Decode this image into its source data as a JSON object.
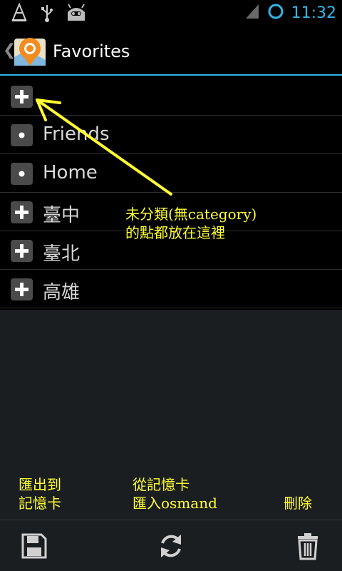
{
  "status_bar": {
    "time": "11:32",
    "left_icons": [
      "vlc-cone-icon",
      "usb-icon",
      "cyanogen-android-icon"
    ],
    "right_icons": [
      "signal-icon",
      "battery-circle-icon"
    ]
  },
  "action_bar": {
    "title": "Favorites",
    "accent_color": "#33b5e5"
  },
  "list": {
    "items": [
      {
        "label": "",
        "icon": "plus-icon"
      },
      {
        "label": "Friends",
        "icon": "dot-icon"
      },
      {
        "label": "Home",
        "icon": "dot-icon"
      },
      {
        "label": "臺中",
        "icon": "plus-icon"
      },
      {
        "label": "臺北",
        "icon": "plus-icon"
      },
      {
        "label": "高雄",
        "icon": "plus-icon"
      }
    ]
  },
  "annotations": {
    "note_line1": "未分類(無category)",
    "note_line2": "的點都放在這裡",
    "export_line1": "匯出到",
    "export_line2": "記憶卡",
    "import_line1": "從記憶卡",
    "import_line2": "匯入osmand",
    "delete": "刪除",
    "color": "#ffff33"
  },
  "bottom_bar": {
    "buttons": [
      "save-icon",
      "refresh-icon",
      "trash-icon"
    ]
  }
}
